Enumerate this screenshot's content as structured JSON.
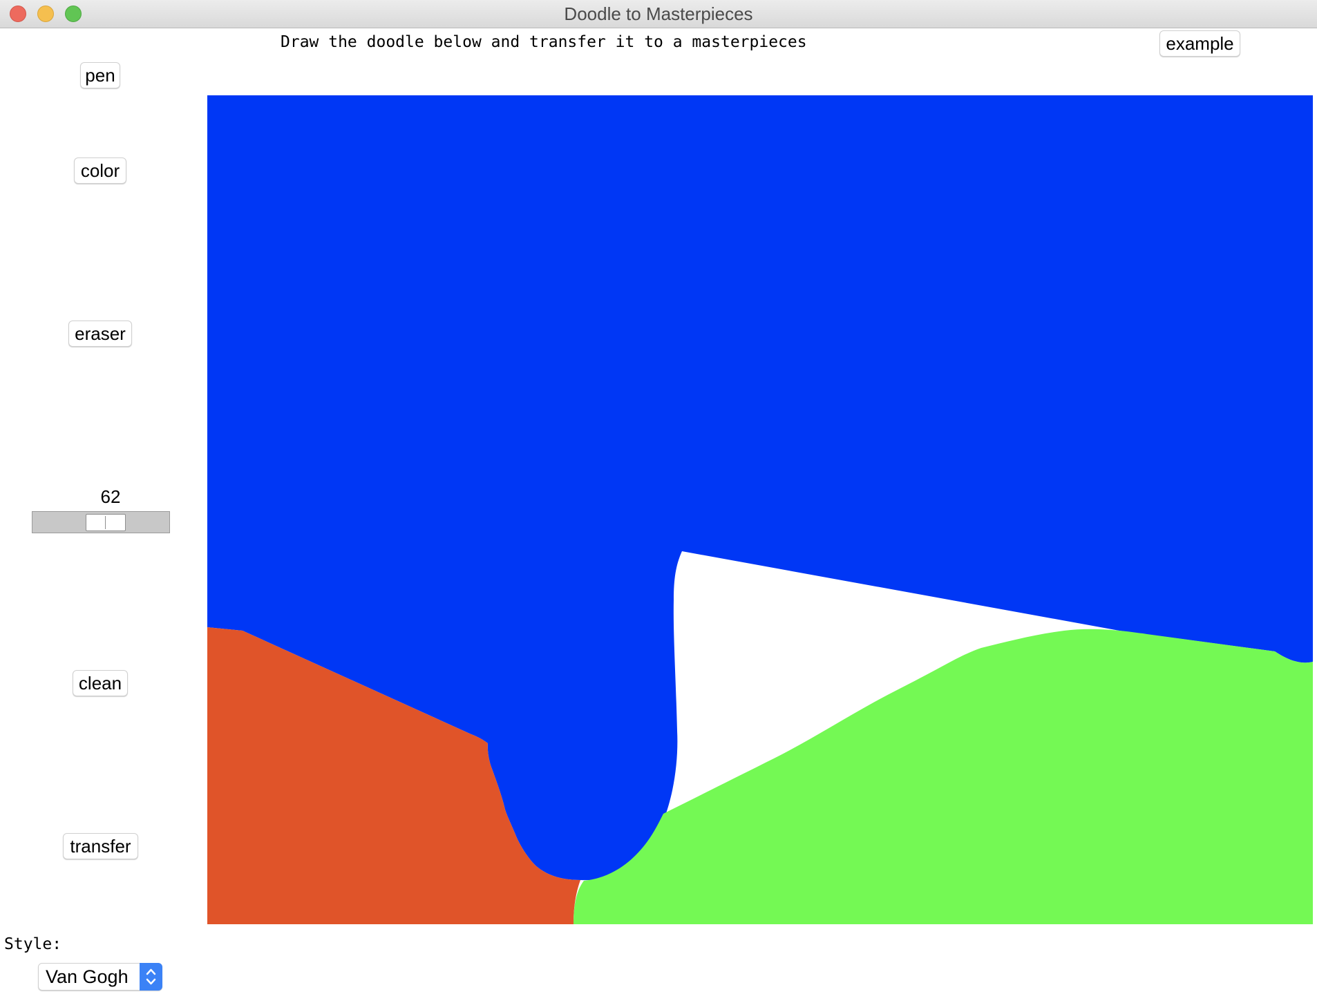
{
  "window": {
    "title": "Doodle to Masterpieces"
  },
  "header": {
    "instruction": "Draw the doodle below and transfer it to a masterpieces",
    "example_label": "example"
  },
  "toolbar": {
    "pen_label": "pen",
    "color_label": "color",
    "eraser_label": "eraser",
    "clean_label": "clean",
    "transfer_label": "transfer"
  },
  "brush_slider": {
    "value": "62",
    "fraction": 0.55
  },
  "canvas": {
    "regions": [
      {
        "name": "blue",
        "color": "#0037F5"
      },
      {
        "name": "orange",
        "color": "#E05429"
      },
      {
        "name": "green",
        "color": "#74F954"
      },
      {
        "name": "background",
        "color": "#FFFFFF"
      }
    ]
  },
  "style": {
    "label": "Style:",
    "selected": "Van Gogh"
  }
}
